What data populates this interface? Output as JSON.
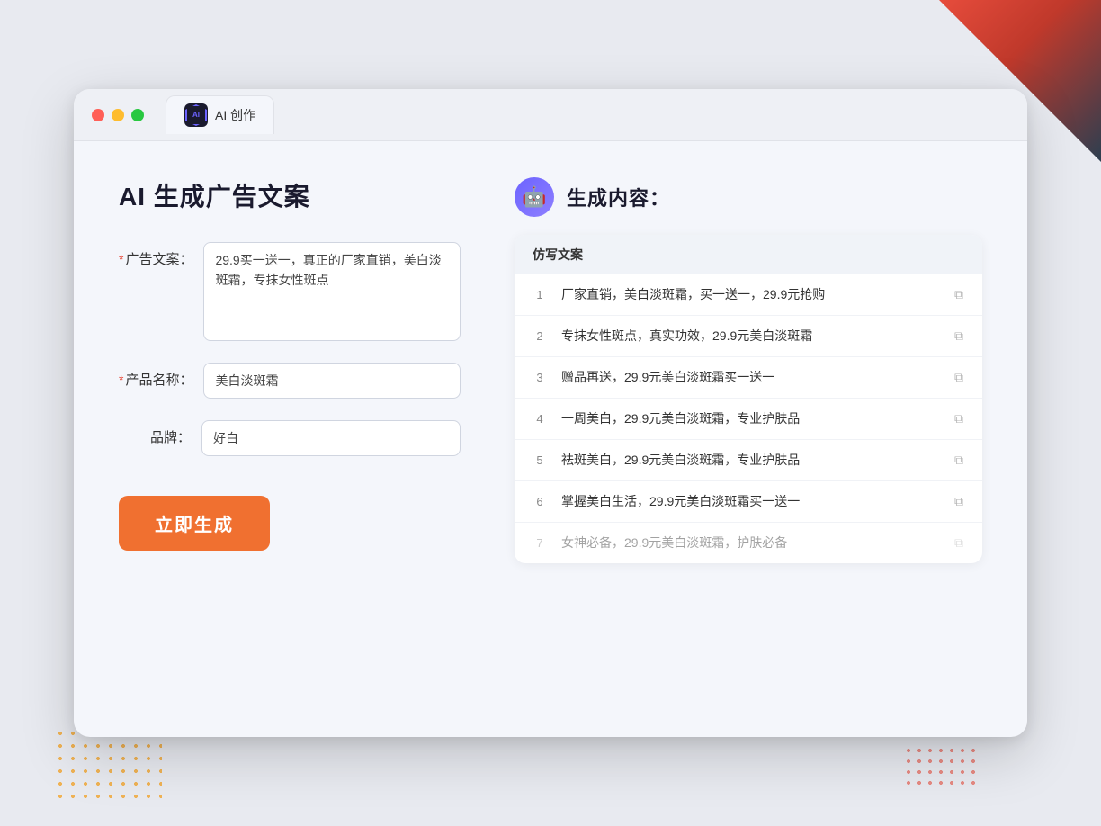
{
  "background": {
    "color": "#e8eaf0"
  },
  "browser": {
    "tab": {
      "logo_text": "AI",
      "label": "AI 创作"
    }
  },
  "left_panel": {
    "title": "AI 生成广告文案",
    "fields": [
      {
        "label": "广告文案：",
        "required": true,
        "type": "textarea",
        "value": "29.9买一送一，真正的厂家直销，美白淡斑霜，专抹女性斑点",
        "placeholder": ""
      },
      {
        "label": "产品名称：",
        "required": true,
        "type": "input",
        "value": "美白淡斑霜",
        "placeholder": ""
      },
      {
        "label": "品牌：",
        "required": false,
        "type": "input",
        "value": "好白",
        "placeholder": ""
      }
    ],
    "generate_button": "立即生成"
  },
  "right_panel": {
    "title": "生成内容：",
    "robot_icon": "robot-icon",
    "table_header": "仿写文案",
    "results": [
      {
        "num": 1,
        "text": "厂家直销，美白淡斑霜，买一送一，29.9元抢购",
        "faded": false
      },
      {
        "num": 2,
        "text": "专抹女性斑点，真实功效，29.9元美白淡斑霜",
        "faded": false
      },
      {
        "num": 3,
        "text": "赠品再送，29.9元美白淡斑霜买一送一",
        "faded": false
      },
      {
        "num": 4,
        "text": "一周美白，29.9元美白淡斑霜，专业护肤品",
        "faded": false
      },
      {
        "num": 5,
        "text": "祛斑美白，29.9元美白淡斑霜，专业护肤品",
        "faded": false
      },
      {
        "num": 6,
        "text": "掌握美白生活，29.9元美白淡斑霜买一送一",
        "faded": false
      },
      {
        "num": 7,
        "text": "女神必备，29.9元美白淡斑霜，护肤必备",
        "faded": true
      }
    ]
  }
}
